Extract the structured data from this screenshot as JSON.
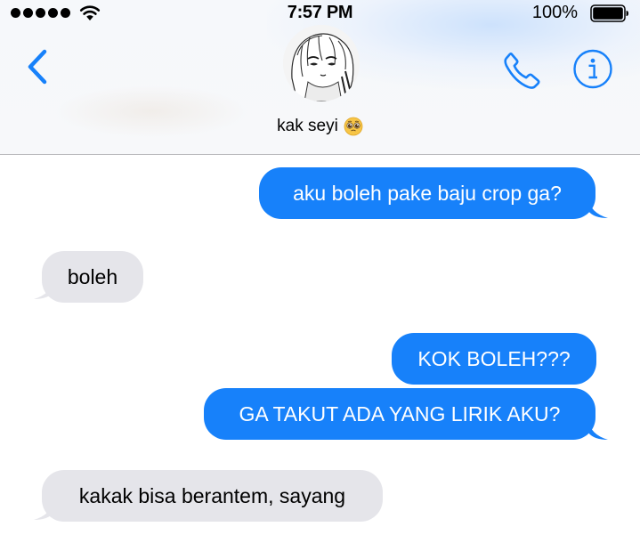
{
  "status_bar": {
    "time": "7:57 PM",
    "battery": "100%",
    "icons": [
      "signal-dots-icon",
      "wifi-icon",
      "battery-icon"
    ]
  },
  "header": {
    "contact_name": "kak seyi",
    "contact_emoji": "pleading-face-emoji",
    "icons": [
      "back-chevron-icon",
      "phone-icon",
      "info-icon"
    ]
  },
  "messages": [
    {
      "direction": "sent",
      "text": "aku boleh pake baju crop ga?"
    },
    {
      "direction": "received",
      "text": "boleh"
    },
    {
      "direction": "sent",
      "text": "KOK BOLEH???"
    },
    {
      "direction": "sent",
      "text": "GA TAKUT ADA YANG LIRIK AKU?"
    },
    {
      "direction": "received",
      "text": "kakak bisa berantem, sayang"
    }
  ],
  "colors": {
    "sent_bubble": "#1781fa",
    "received_bubble": "#e5e5ea",
    "accent": "#1781fa"
  }
}
